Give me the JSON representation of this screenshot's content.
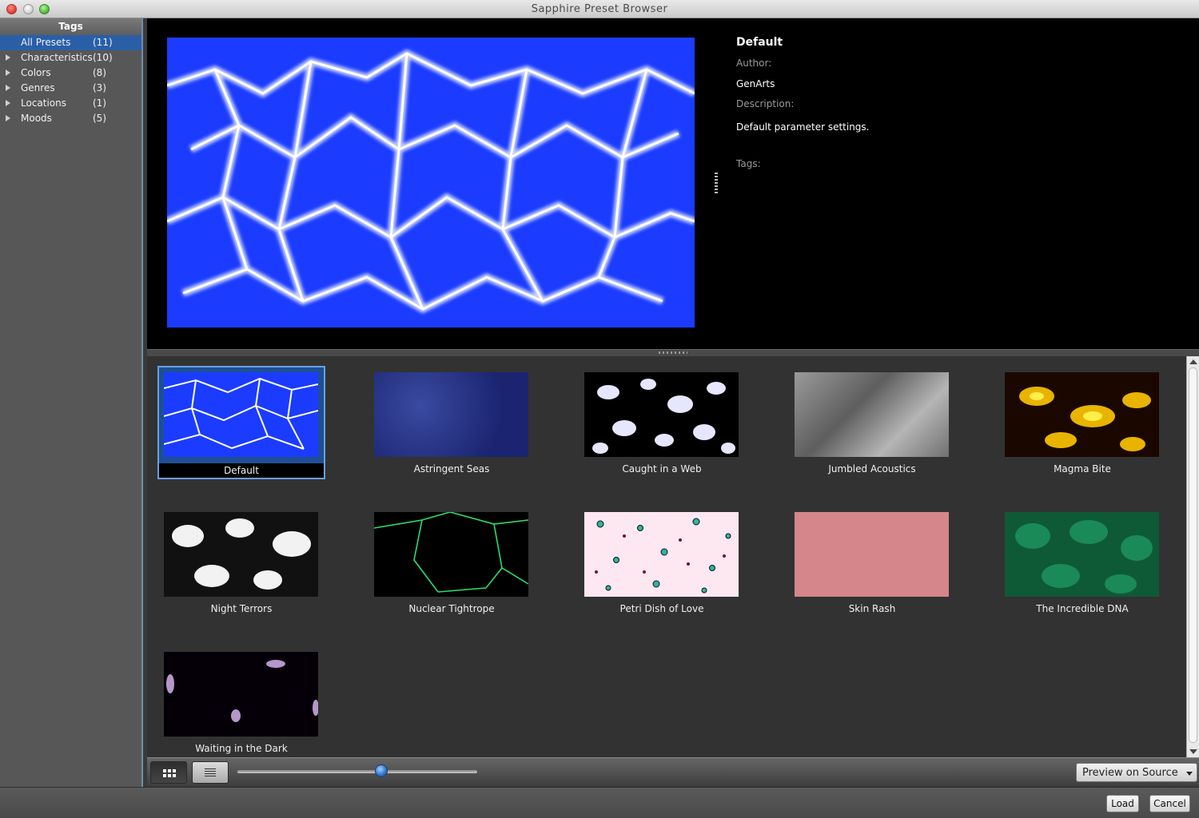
{
  "window": {
    "title": "Sapphire Preset Browser"
  },
  "sidebar": {
    "header": "Tags",
    "items": [
      {
        "name": "All Presets",
        "count": "(11)",
        "selected": true,
        "expandable": false
      },
      {
        "name": "Characteristics",
        "count": "(10)",
        "selected": false,
        "expandable": true
      },
      {
        "name": "Colors",
        "count": "(8)",
        "selected": false,
        "expandable": true
      },
      {
        "name": "Genres",
        "count": "(3)",
        "selected": false,
        "expandable": true
      },
      {
        "name": "Locations",
        "count": "(1)",
        "selected": false,
        "expandable": true
      },
      {
        "name": "Moods",
        "count": "(5)",
        "selected": false,
        "expandable": true
      }
    ]
  },
  "details": {
    "name": "Default",
    "author_label": "Author:",
    "author": "GenArts",
    "description_label": "Description:",
    "description": "Default parameter settings.",
    "tags_label": "Tags:"
  },
  "presets": [
    {
      "name": "Default",
      "selected": true
    },
    {
      "name": "Astringent Seas"
    },
    {
      "name": "Caught in a Web"
    },
    {
      "name": "Jumbled Acoustics"
    },
    {
      "name": "Magma Bite"
    },
    {
      "name": "Night Terrors"
    },
    {
      "name": "Nuclear Tightrope"
    },
    {
      "name": "Petri Dish of Love"
    },
    {
      "name": "Skin Rash"
    },
    {
      "name": "The Incredible DNA"
    },
    {
      "name": "Waiting in the Dark"
    }
  ],
  "toolbar": {
    "view_grid_icon": "grid-icon",
    "view_list_icon": "list-icon",
    "thumbnail_size_level": 0.6,
    "preview_mode": "Preview on Source"
  },
  "footer": {
    "load_label": "Load",
    "cancel_label": "Cancel"
  },
  "colors": {
    "selection": "#2a5fa8",
    "background": "#323232",
    "preview_blue": "#1b3cff"
  }
}
